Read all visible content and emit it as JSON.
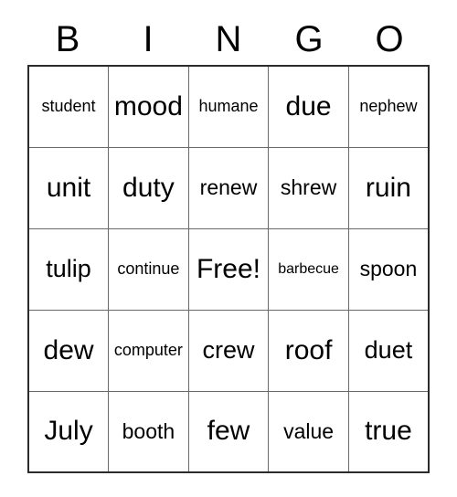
{
  "card": {
    "type": "bingo-card",
    "columns": 5,
    "rows": 5,
    "header": {
      "letters": [
        "B",
        "I",
        "N",
        "G",
        "O"
      ]
    },
    "colors": {
      "background": "#ffffff",
      "text": "#000000",
      "outer_border": "#2b2b2b",
      "inner_border": "#6a6a6a"
    },
    "free_space": {
      "label": "Free!",
      "row": 3,
      "column": 3
    },
    "cells": [
      [
        {
          "text": "student",
          "size": "sm"
        },
        {
          "text": "mood",
          "size": "xl"
        },
        {
          "text": "humane",
          "size": "sm"
        },
        {
          "text": "due",
          "size": "xl"
        },
        {
          "text": "nephew",
          "size": "sm"
        }
      ],
      [
        {
          "text": "unit",
          "size": "xl"
        },
        {
          "text": "duty",
          "size": "xl"
        },
        {
          "text": "renew",
          "size": "md"
        },
        {
          "text": "shrew",
          "size": "md"
        },
        {
          "text": "ruin",
          "size": "xl"
        }
      ],
      [
        {
          "text": "tulip",
          "size": "lg"
        },
        {
          "text": "continue",
          "size": "sm"
        },
        {
          "text": "Free!",
          "size": "xl"
        },
        {
          "text": "barbecue",
          "size": "xs"
        },
        {
          "text": "spoon",
          "size": "md"
        }
      ],
      [
        {
          "text": "dew",
          "size": "xl"
        },
        {
          "text": "computer",
          "size": "sm"
        },
        {
          "text": "crew",
          "size": "lg"
        },
        {
          "text": "roof",
          "size": "xl"
        },
        {
          "text": "duet",
          "size": "lg"
        }
      ],
      [
        {
          "text": "July",
          "size": "xl"
        },
        {
          "text": "booth",
          "size": "md"
        },
        {
          "text": "few",
          "size": "xl"
        },
        {
          "text": "value",
          "size": "md"
        },
        {
          "text": "true",
          "size": "xl"
        }
      ]
    ]
  }
}
